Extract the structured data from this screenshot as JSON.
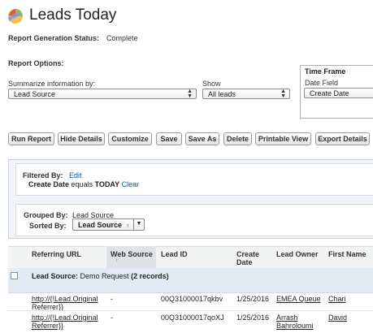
{
  "title": "Leads Today",
  "logo_icon": "report-logo-icon",
  "status": {
    "label": "Report Generation Status:",
    "value": "Complete"
  },
  "options": {
    "label": "Report Options:",
    "summarize_label": "Summarize information by:",
    "summarize_value": "Lead Source",
    "show_label": "Show",
    "show_value": "All leads",
    "timeframe_title": "Time Frame",
    "date_field_label": "Date Field",
    "date_field_value": "Create Date"
  },
  "buttons": [
    "Run Report",
    "Hide Details",
    "Customize",
    "Save",
    "Save As",
    "Delete",
    "Printable View",
    "Export Details"
  ],
  "filter": {
    "label": "Filtered By:",
    "edit": "Edit",
    "field": "Create Date",
    "operator": "equals",
    "value": "TODAY",
    "clear": "Clear"
  },
  "grouping": {
    "grouped_label": "Grouped By:",
    "grouped_value": "Lead Source",
    "sorted_label": "Sorted By:",
    "sorted_value": "Lead Source",
    "sort_indicator": "↑"
  },
  "table": {
    "columns": [
      "Referring URL",
      "Web Source",
      "Lead ID",
      "Create Date",
      "Lead Owner",
      "First Name"
    ],
    "sort_icon": "↑",
    "group_label": "Lead Source:",
    "group_value": "Demo Request",
    "group_count": "(2 records)",
    "rows": [
      {
        "url": "http://{!Lead.Original Referrer}}",
        "web_source": "-",
        "lead_id": "00Q31000017qkbv",
        "create_date": "1/25/2016",
        "owner": "EMEA Queue",
        "first_name": "Chari"
      },
      {
        "url": "http://{!Lead.Original Referrer}}",
        "web_source": "-",
        "lead_id": "00Q31000017qoXJ",
        "create_date": "1/25/2016",
        "owner": "Arrash Bahroloumi",
        "first_name": "David"
      }
    ]
  },
  "colors": {
    "link": "#015ba7",
    "group_row": "#e4eaf3",
    "panel": "#f2f4f7"
  }
}
